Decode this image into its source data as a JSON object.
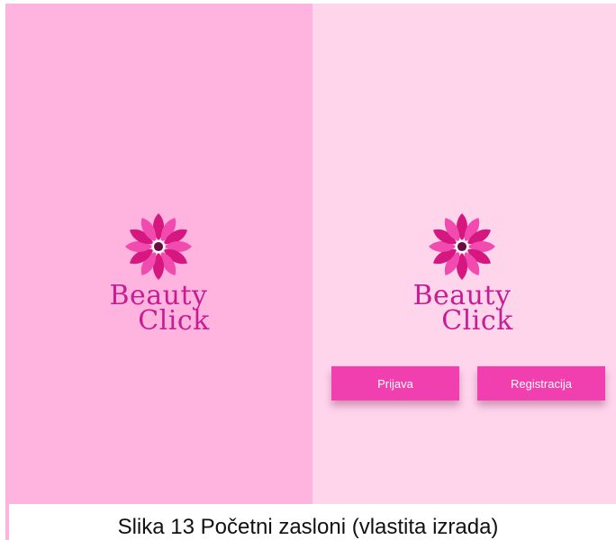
{
  "screens": {
    "splash": {
      "logo_line1": "Beauty",
      "logo_line2": "Click",
      "background": "#ffb3df"
    },
    "start": {
      "logo_line1": "Beauty",
      "logo_line2": "Click",
      "background": "#ffd5ec",
      "login_label": "Prijava",
      "register_label": "Registracija"
    }
  },
  "caption": "Slika 13 Početni zasloni (vlastita izrada)",
  "colors": {
    "brand": "#c81d92",
    "button": "#f23fb0",
    "petal_dark": "#d6177f",
    "petal_light": "#f24bb0"
  },
  "icons": {
    "logo": "flower-icon"
  }
}
